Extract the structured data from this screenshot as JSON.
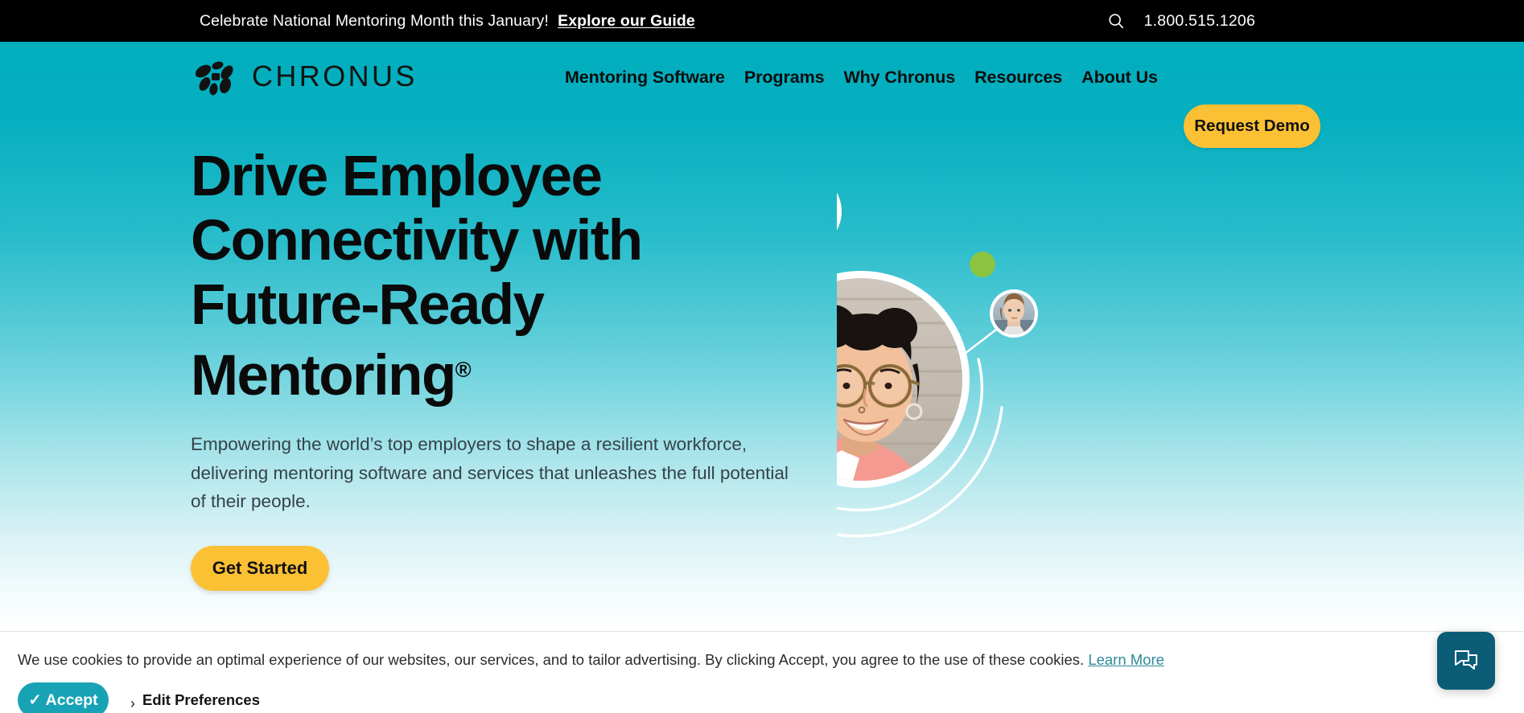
{
  "topbar": {
    "message_plain": "Celebrate National Mentoring Month this January!",
    "message_link": "Explore our Guide",
    "search_icon": "search-icon",
    "phone": "1.800.515.1206"
  },
  "header": {
    "logo_text": "CHRONUS",
    "logo_mark": "chronus-petal-cluster-icon",
    "nav": [
      {
        "label": "Mentoring Software"
      },
      {
        "label": "Programs"
      },
      {
        "label": "Why Chronus"
      },
      {
        "label": "Resources"
      },
      {
        "label": "About Us"
      }
    ],
    "demo_button": "Request Demo"
  },
  "hero": {
    "headline_line1": "Drive Employee",
    "headline_line2": "Connectivity with",
    "headline_line3": "Future-Ready",
    "headline_line4": "Mentoring",
    "headline_registered": "®",
    "subcopy": "Empowering the world’s top employers to shape a resilient workforce, delivering mentoring software and services that unleashes the full potential of their people.",
    "cta_button": "Get Started",
    "graphic": {
      "description": "network-of-portraits-graphic",
      "nodes": [
        {
          "name": "portrait-top",
          "type": "avatar"
        },
        {
          "name": "portrait-center",
          "type": "avatar-large"
        },
        {
          "name": "portrait-right",
          "type": "avatar-small"
        },
        {
          "name": "dot-dark-teal",
          "type": "dot",
          "color": "#0e5675"
        },
        {
          "name": "dot-green",
          "type": "dot",
          "color": "#8cc440"
        },
        {
          "name": "dot-yellow",
          "type": "dot",
          "color": "#fcc334"
        }
      ]
    }
  },
  "cookie": {
    "text_before": "We use cookies to provide an optimal experience of our websites, our services, and to tailor advertising. By clicking Accept, you agree to the use of these cookies. ",
    "learn_more": "Learn More",
    "accept_button": "Accept",
    "accept_check": "✓",
    "edit_preferences": "Edit Preferences",
    "chevron": "›"
  },
  "chat": {
    "icon": "chat-bubbles-icon"
  },
  "colors": {
    "topbar_bg": "#000000",
    "hero_top": "#00aebe",
    "hero_bottom": "#ffffff",
    "accent_yellow": "#fcc034",
    "accept_teal": "#17a3b5",
    "chat_dark_teal": "#0b5d77",
    "link_teal": "#2e8a99"
  }
}
